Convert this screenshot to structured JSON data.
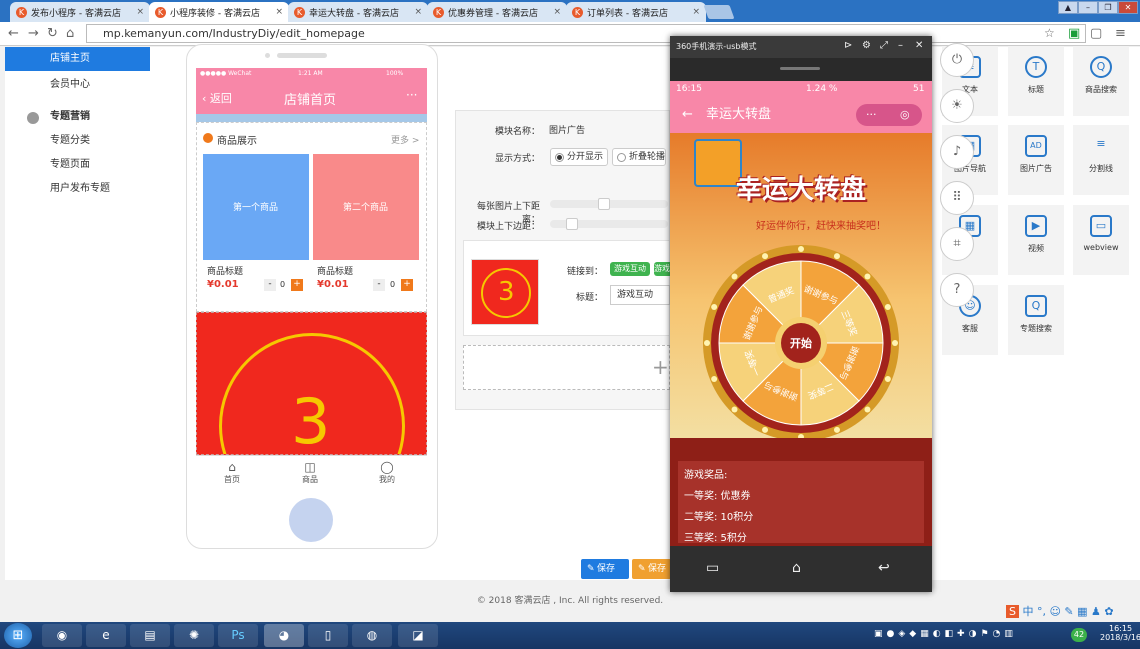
{
  "browser": {
    "tabs": [
      {
        "label": "发布小程序 - 客满云店",
        "active": false
      },
      {
        "label": "小程序装修 - 客满云店",
        "active": true
      },
      {
        "label": "幸运大转盘 - 客满云店",
        "active": false
      },
      {
        "label": "优惠券管理 - 客满云店",
        "active": false
      },
      {
        "label": "订单列表 - 客满云店",
        "active": false
      }
    ],
    "url": "mp.kemanyun.com/IndustryDiy/edit_homepage",
    "tab_favicon": "K",
    "tab_close": "×"
  },
  "sidebar": {
    "items": [
      {
        "label": "店铺主页",
        "active": true
      },
      {
        "label": "会员中心",
        "active": false
      }
    ],
    "group_title": "专题营销",
    "group_items": [
      "专题分类",
      "专题页面",
      "用户发布专题"
    ]
  },
  "phone_preview": {
    "status_left": "●●●●● WeChat",
    "status_time": "1:21 AM",
    "status_right": "100%",
    "back": "返回",
    "title": "店铺首页",
    "menu": "···",
    "section_title": "商品展示",
    "section_more": "更多 >",
    "products": [
      {
        "image_text": "第一个商品",
        "name": "商品标题",
        "price": "¥0.01",
        "qty": "0",
        "color": "#6aa8f5"
      },
      {
        "image_text": "第二个商品",
        "name": "商品标题",
        "price": "¥0.01",
        "qty": "0",
        "color": "#f98a8a"
      }
    ],
    "qty_minus": "-",
    "qty_plus": "+",
    "banner_number": "3",
    "tabbar": [
      "首页",
      "商品",
      "我的"
    ]
  },
  "form": {
    "module_name_label": "模块名称：",
    "module_name_value": "图片广告",
    "display_label": "显示方式：",
    "display_options": [
      "分开显示",
      "折叠轮播"
    ],
    "img_spacing_label": "每张图片上下距离：",
    "module_spacing_label": "模块上下边距：",
    "thumb_number": "3",
    "link_label": "链接到：",
    "link_value": "游戏互动",
    "link_value2": "游戏",
    "title_label": "标题：",
    "title_value": "游戏互动",
    "add_symbol": "+",
    "save": "保存",
    "save2": "保存"
  },
  "emulator": {
    "window_title": "360手机演示-usb模式",
    "status_time": "16:15",
    "status_right": "1.24 %",
    "battery": "51",
    "page_title": "幸运大转盘",
    "game_title": "幸运大转盘",
    "slogan": "好运伴你行，赶快来抽奖吧！",
    "wheel_center": "开始",
    "wheel_sectors": [
      "谢谢参与",
      "三等奖",
      "谢谢参与",
      "二等奖",
      "谢谢参与",
      "一等奖",
      "谢谢参与",
      "普通奖"
    ],
    "prizes_title": "游戏奖品:",
    "prizes": [
      "一等奖: 优惠券",
      "二等奖: 10积分",
      "三等奖: 5积分"
    ]
  },
  "tools": [
    {
      "label": "文本",
      "icon": "text-icon"
    },
    {
      "label": "标题",
      "icon": "title-icon",
      "glyph": "T"
    },
    {
      "label": "商品搜索",
      "icon": "search-icon",
      "glyph": "Q"
    },
    {
      "label": "图片导航",
      "icon": "image-nav-icon"
    },
    {
      "label": "图片广告",
      "icon": "image-ad-icon",
      "glyph": "AD"
    },
    {
      "label": "分割线",
      "icon": "divider-icon",
      "glyph": "≡"
    },
    {
      "label": "",
      "icon": "grid-icon"
    },
    {
      "label": "视频",
      "icon": "video-icon",
      "glyph": "▶"
    },
    {
      "label": "webview",
      "icon": "webview-icon",
      "glyph": "▭"
    },
    {
      "label": "客服",
      "icon": "service-icon"
    },
    {
      "label": "专题搜索",
      "icon": "topic-search-icon",
      "glyph": "Q"
    }
  ],
  "footer": "© 2018 客满云店 , Inc. All rights reserved.",
  "taskbar": {
    "time": "16:15",
    "date": "2018/3/16",
    "notify_count": "42"
  }
}
